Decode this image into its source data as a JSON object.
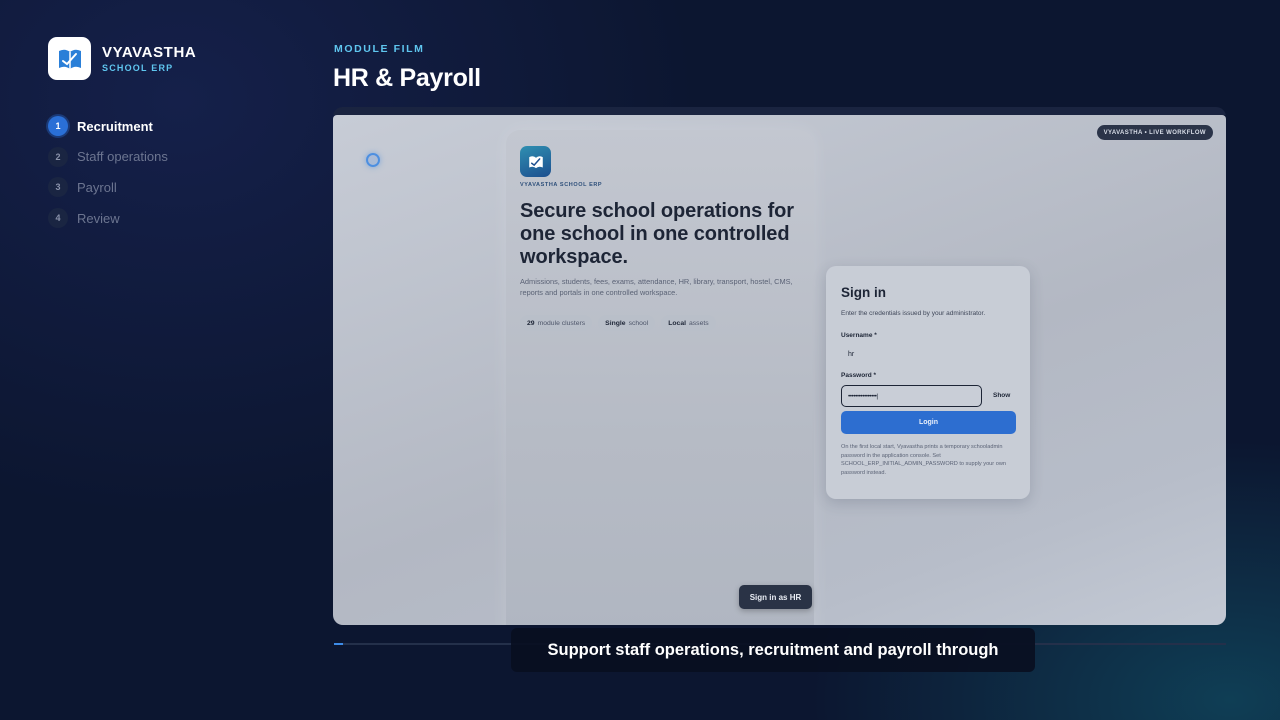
{
  "brand": {
    "name": "VYAVASTHA",
    "subtitle": "SCHOOL ERP",
    "logo_icon": "book-icon"
  },
  "steps": [
    {
      "number": "1",
      "label": "Recruitment",
      "active": true
    },
    {
      "number": "2",
      "label": "Staff operations",
      "active": false
    },
    {
      "number": "3",
      "label": "Payroll",
      "active": false
    },
    {
      "number": "4",
      "label": "Review",
      "active": false
    }
  ],
  "header": {
    "kicker": "MODULE FILM",
    "title": "HR & Payroll"
  },
  "video": {
    "live_badge": "VYAVASTHA • LIVE WORKFLOW",
    "hero": {
      "kicker": "VYAVASTHA SCHOOL ERP",
      "title": "Secure school operations for one school in one controlled workspace.",
      "description": "Admissions, students, fees, exams, attendance, HR, library, transport, hostel, CMS, reports and portals in one controlled workspace.",
      "pills": [
        {
          "strong": "29",
          "text": "module clusters"
        },
        {
          "strong": "Single",
          "text": "school"
        },
        {
          "strong": "Local",
          "text": "assets"
        }
      ],
      "hr_button": "Sign in as HR"
    },
    "signin": {
      "title": "Sign in",
      "subtitle": "Enter the credentials issued by your administrator.",
      "username_label": "Username *",
      "username_value": "hr",
      "password_label": "Password *",
      "password_value": "••••••••••••••••|",
      "show_label": "Show",
      "login_label": "Login",
      "note": "On the first local start, Vyavastha prints a temporary schooladmin password in the application console. Set SCHOOL_ERP_INITIAL_ADMIN_PASSWORD to supply your own password instead."
    }
  },
  "progress": {
    "fraction": 0.01
  },
  "caption": "Support staff operations, recruitment and payroll through",
  "colors": {
    "accent": "#5fc6ef",
    "active_step": "#2a6fd6",
    "background": "#0c1630",
    "login_button": "#2d6ed0"
  }
}
